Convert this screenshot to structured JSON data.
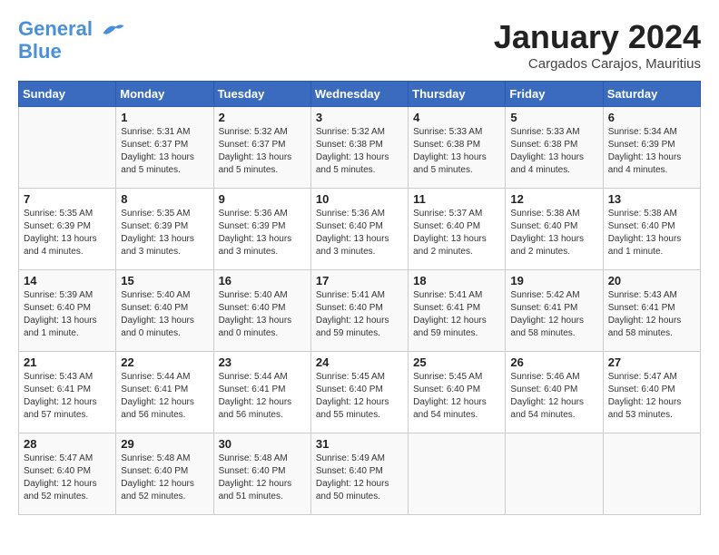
{
  "header": {
    "logo_line1": "General",
    "logo_line2": "Blue",
    "month_title": "January 2024",
    "subtitle": "Cargados Carajos, Mauritius"
  },
  "days_of_week": [
    "Sunday",
    "Monday",
    "Tuesday",
    "Wednesday",
    "Thursday",
    "Friday",
    "Saturday"
  ],
  "weeks": [
    [
      {
        "day": "",
        "info": ""
      },
      {
        "day": "1",
        "info": "Sunrise: 5:31 AM\nSunset: 6:37 PM\nDaylight: 13 hours\nand 5 minutes."
      },
      {
        "day": "2",
        "info": "Sunrise: 5:32 AM\nSunset: 6:37 PM\nDaylight: 13 hours\nand 5 minutes."
      },
      {
        "day": "3",
        "info": "Sunrise: 5:32 AM\nSunset: 6:38 PM\nDaylight: 13 hours\nand 5 minutes."
      },
      {
        "day": "4",
        "info": "Sunrise: 5:33 AM\nSunset: 6:38 PM\nDaylight: 13 hours\nand 5 minutes."
      },
      {
        "day": "5",
        "info": "Sunrise: 5:33 AM\nSunset: 6:38 PM\nDaylight: 13 hours\nand 4 minutes."
      },
      {
        "day": "6",
        "info": "Sunrise: 5:34 AM\nSunset: 6:39 PM\nDaylight: 13 hours\nand 4 minutes."
      }
    ],
    [
      {
        "day": "7",
        "info": "Sunrise: 5:35 AM\nSunset: 6:39 PM\nDaylight: 13 hours\nand 4 minutes."
      },
      {
        "day": "8",
        "info": "Sunrise: 5:35 AM\nSunset: 6:39 PM\nDaylight: 13 hours\nand 3 minutes."
      },
      {
        "day": "9",
        "info": "Sunrise: 5:36 AM\nSunset: 6:39 PM\nDaylight: 13 hours\nand 3 minutes."
      },
      {
        "day": "10",
        "info": "Sunrise: 5:36 AM\nSunset: 6:40 PM\nDaylight: 13 hours\nand 3 minutes."
      },
      {
        "day": "11",
        "info": "Sunrise: 5:37 AM\nSunset: 6:40 PM\nDaylight: 13 hours\nand 2 minutes."
      },
      {
        "day": "12",
        "info": "Sunrise: 5:38 AM\nSunset: 6:40 PM\nDaylight: 13 hours\nand 2 minutes."
      },
      {
        "day": "13",
        "info": "Sunrise: 5:38 AM\nSunset: 6:40 PM\nDaylight: 13 hours\nand 1 minute."
      }
    ],
    [
      {
        "day": "14",
        "info": "Sunrise: 5:39 AM\nSunset: 6:40 PM\nDaylight: 13 hours\nand 1 minute."
      },
      {
        "day": "15",
        "info": "Sunrise: 5:40 AM\nSunset: 6:40 PM\nDaylight: 13 hours\nand 0 minutes."
      },
      {
        "day": "16",
        "info": "Sunrise: 5:40 AM\nSunset: 6:40 PM\nDaylight: 13 hours\nand 0 minutes."
      },
      {
        "day": "17",
        "info": "Sunrise: 5:41 AM\nSunset: 6:40 PM\nDaylight: 12 hours\nand 59 minutes."
      },
      {
        "day": "18",
        "info": "Sunrise: 5:41 AM\nSunset: 6:41 PM\nDaylight: 12 hours\nand 59 minutes."
      },
      {
        "day": "19",
        "info": "Sunrise: 5:42 AM\nSunset: 6:41 PM\nDaylight: 12 hours\nand 58 minutes."
      },
      {
        "day": "20",
        "info": "Sunrise: 5:43 AM\nSunset: 6:41 PM\nDaylight: 12 hours\nand 58 minutes."
      }
    ],
    [
      {
        "day": "21",
        "info": "Sunrise: 5:43 AM\nSunset: 6:41 PM\nDaylight: 12 hours\nand 57 minutes."
      },
      {
        "day": "22",
        "info": "Sunrise: 5:44 AM\nSunset: 6:41 PM\nDaylight: 12 hours\nand 56 minutes."
      },
      {
        "day": "23",
        "info": "Sunrise: 5:44 AM\nSunset: 6:41 PM\nDaylight: 12 hours\nand 56 minutes."
      },
      {
        "day": "24",
        "info": "Sunrise: 5:45 AM\nSunset: 6:40 PM\nDaylight: 12 hours\nand 55 minutes."
      },
      {
        "day": "25",
        "info": "Sunrise: 5:45 AM\nSunset: 6:40 PM\nDaylight: 12 hours\nand 54 minutes."
      },
      {
        "day": "26",
        "info": "Sunrise: 5:46 AM\nSunset: 6:40 PM\nDaylight: 12 hours\nand 54 minutes."
      },
      {
        "day": "27",
        "info": "Sunrise: 5:47 AM\nSunset: 6:40 PM\nDaylight: 12 hours\nand 53 minutes."
      }
    ],
    [
      {
        "day": "28",
        "info": "Sunrise: 5:47 AM\nSunset: 6:40 PM\nDaylight: 12 hours\nand 52 minutes."
      },
      {
        "day": "29",
        "info": "Sunrise: 5:48 AM\nSunset: 6:40 PM\nDaylight: 12 hours\nand 52 minutes."
      },
      {
        "day": "30",
        "info": "Sunrise: 5:48 AM\nSunset: 6:40 PM\nDaylight: 12 hours\nand 51 minutes."
      },
      {
        "day": "31",
        "info": "Sunrise: 5:49 AM\nSunset: 6:40 PM\nDaylight: 12 hours\nand 50 minutes."
      },
      {
        "day": "",
        "info": ""
      },
      {
        "day": "",
        "info": ""
      },
      {
        "day": "",
        "info": ""
      }
    ]
  ]
}
